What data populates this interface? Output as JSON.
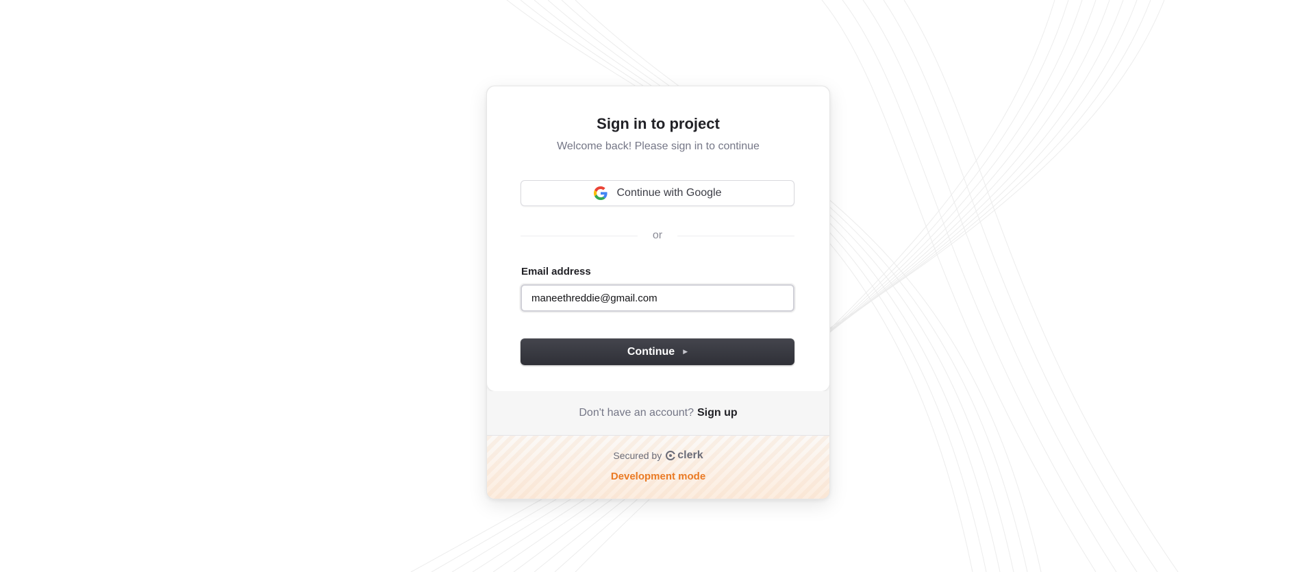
{
  "header": {
    "title": "Sign in to project",
    "subtitle": "Welcome back! Please sign in to continue"
  },
  "social": {
    "google_label": "Continue with Google",
    "google_icon": "google-g-icon"
  },
  "divider": {
    "label": "or"
  },
  "form": {
    "email_label": "Email address",
    "email_value": "maneethreddie@gmail.com",
    "continue_label": "Continue",
    "continue_icon": "play-arrow-icon"
  },
  "signup": {
    "prompt": "Don't have an account?",
    "link": "Sign up"
  },
  "footer": {
    "secured_by": "Secured by",
    "brand": "clerk",
    "brand_icon": "clerk-logo-icon",
    "mode": "Development mode"
  },
  "colors": {
    "primary_button": "#2f3037",
    "dev_mode": "#ea7a24",
    "text_primary": "#212126",
    "text_muted": "#747686"
  }
}
